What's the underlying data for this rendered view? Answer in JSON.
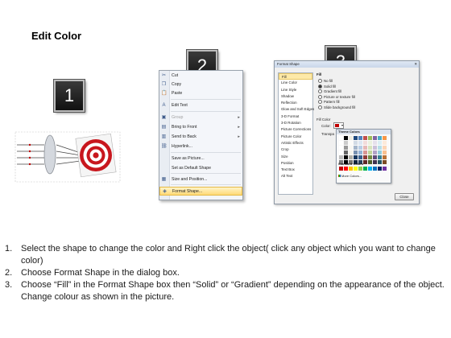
{
  "page": {
    "title": "Edit Color"
  },
  "badges": [
    "1",
    "2",
    "3"
  ],
  "context_menu": {
    "items": [
      {
        "icon": "scissors-icon",
        "glyph": "✂",
        "label": "Cut",
        "disabled": false,
        "submenu": false
      },
      {
        "icon": "copy-icon",
        "glyph": "❐",
        "label": "Copy",
        "disabled": false,
        "submenu": false
      },
      {
        "icon": "paste-icon",
        "glyph": "📋",
        "label": "Paste",
        "disabled": false,
        "submenu": false
      },
      {
        "icon": "edit-text-icon",
        "glyph": "A",
        "label": "Edit Text",
        "disabled": false,
        "submenu": false
      },
      {
        "icon": "group-icon",
        "glyph": "▣",
        "label": "Group",
        "disabled": true,
        "submenu": true
      },
      {
        "icon": "bring-front-icon",
        "glyph": "▤",
        "label": "Bring to Front",
        "disabled": false,
        "submenu": true
      },
      {
        "icon": "send-back-icon",
        "glyph": "▥",
        "label": "Send to Back",
        "disabled": false,
        "submenu": true
      },
      {
        "icon": "hyperlink-icon",
        "glyph": "⛓",
        "label": "Hyperlink...",
        "disabled": false,
        "submenu": false
      },
      {
        "icon": "save-picture-icon",
        "glyph": "",
        "label": "Save as Picture...",
        "disabled": false,
        "submenu": false
      },
      {
        "icon": "default-shape-icon",
        "glyph": "",
        "label": "Set as Default Shape",
        "disabled": false,
        "submenu": false
      },
      {
        "icon": "size-position-icon",
        "glyph": "▦",
        "label": "Size and Position...",
        "disabled": false,
        "submenu": false
      },
      {
        "icon": "format-shape-icon",
        "glyph": "◈",
        "label": "Format Shape...",
        "disabled": false,
        "submenu": false,
        "highlighted": true
      }
    ]
  },
  "dialog": {
    "title": "Format Shape",
    "close_glyph": "✕",
    "nav": [
      "Fill",
      "Line Color",
      "Line Style",
      "Shadow",
      "Reflection",
      "Glow and Soft Edges",
      "3-D Format",
      "3-D Rotation",
      "Picture Corrections",
      "Picture Color",
      "Artistic Effects",
      "Crop",
      "Size",
      "Position",
      "Text Box",
      "Alt Text"
    ],
    "pane_heading": "Fill",
    "options": [
      "No fill",
      "Solid fill",
      "Gradient fill",
      "Picture or texture fill",
      "Pattern fill",
      "Slide background fill"
    ],
    "selected_option": 1,
    "fill_color_heading": "Fill Color",
    "color_label": "Color:",
    "transparency_label": "Transpa",
    "close_button": "Close"
  },
  "palette": {
    "theme_label": "Theme Colors",
    "standard_label": "Standard Colors",
    "more_label": "More Colors...",
    "theme_top": [
      "#ffffff",
      "#000000",
      "#eeece1",
      "#1f497d",
      "#4f81bd",
      "#c0504d",
      "#9bbb59",
      "#8064a2",
      "#4bacc6",
      "#f79646"
    ],
    "standard": [
      "#c00000",
      "#ff0000",
      "#ffc000",
      "#ffff00",
      "#92d050",
      "#00b050",
      "#00b0f0",
      "#0070c0",
      "#002060",
      "#7030a0"
    ]
  },
  "instructions": [
    {
      "num": "1.",
      "text": "Select the shape to change the color and Right click the object( click any object which you want to change color)"
    },
    {
      "num": "2.",
      "text": "Choose Format Shape in the dialog box."
    },
    {
      "num": "3.",
      "text": "Choose “Fill” in the Format Shape box then “Solid” or “Gradient” depending on the appearance of the object. Change colour as shown in the picture."
    }
  ]
}
